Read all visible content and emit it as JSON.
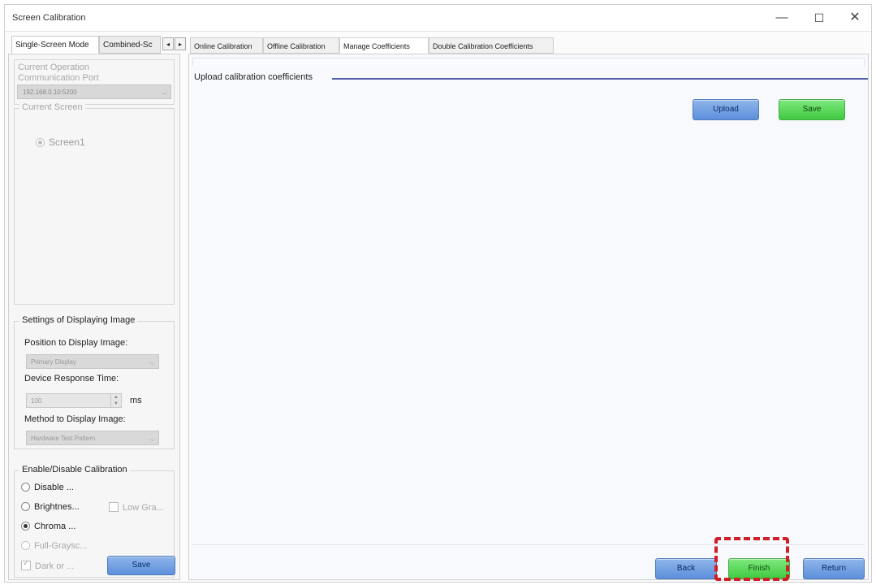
{
  "window": {
    "title": "Screen Calibration",
    "minimize": "—",
    "maximize": "☐",
    "close": "✕"
  },
  "left_tabs": {
    "single": "Single-Screen Mode",
    "combined": "Combined-Sc",
    "scroll_left": "◂",
    "scroll_right": "▸"
  },
  "operation_port": {
    "label_line1": "Current Operation",
    "label_line2": "Communication Port",
    "value": "192.168.0.10:5200"
  },
  "current_screen": {
    "title": "Current Screen",
    "screen": "Screen1"
  },
  "display_settings": {
    "title": "Settings of Displaying Image",
    "position_label": "Position to Display Image:",
    "position_value": "Primary Display",
    "response_label": "Device Response Time:",
    "response_value": "100",
    "response_unit": "ms",
    "method_label": "Method to Display Image:",
    "method_value": "Hardware Test Pattern"
  },
  "calibration": {
    "title": "Enable/Disable Calibration",
    "disable": "Disable ...",
    "brightness": "Brightnes...",
    "low_gray": "Low Gra...",
    "chroma": "Chroma ...",
    "full_gray": "Full-Graysc...",
    "dark": "Dark or ...",
    "save": "Save"
  },
  "right_tabs": {
    "online": "Online Calibration",
    "offline": "Offline Calibration",
    "manage": "Manage Coefficients",
    "double": "Double Calibration Coefficients"
  },
  "upload_section": {
    "title": "Upload calibration coefficients",
    "upload": "Upload",
    "save": "Save"
  },
  "bottom": {
    "back": "Back",
    "finish": "Finish",
    "return": "Return"
  }
}
